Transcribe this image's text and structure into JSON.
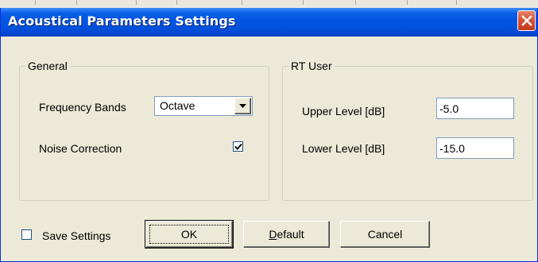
{
  "window": {
    "title": "Acoustical Parameters Settings"
  },
  "general": {
    "group_label": "General",
    "frequency_bands_label": "Frequency Bands",
    "frequency_bands_value": "Octave",
    "noise_correction_label": "Noise Correction",
    "noise_correction_checked": true
  },
  "rt_user": {
    "group_label": "RT User",
    "upper_level_label": "Upper Level [dB]",
    "upper_level_value": "-5.0",
    "lower_level_label": "Lower Level [dB]",
    "lower_level_value": "-15.0"
  },
  "footer": {
    "save_settings_label": "Save Settings",
    "save_settings_checked": false,
    "ok_label": "OK",
    "default_mnemonic": "D",
    "default_rest": "efault",
    "cancel_label": "Cancel"
  },
  "icons": {
    "close": "close-icon",
    "dropdown": "chevron-down-icon",
    "check": "checkmark-icon"
  },
  "colors": {
    "titlebar": "#0154e3",
    "close_button": "#d9553a",
    "dialog_face": "#ece9d8"
  }
}
